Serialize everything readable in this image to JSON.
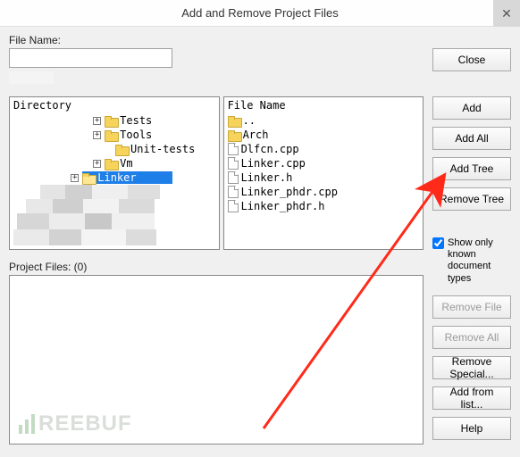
{
  "title": "Add and Remove Project Files",
  "file_name_label": "File Name:",
  "directory_header": "Directory",
  "filelist_header": "File Name",
  "tree": {
    "items": [
      {
        "label": "Tests"
      },
      {
        "label": "Tools"
      },
      {
        "label": "Unit-tests"
      },
      {
        "label": "Vm"
      },
      {
        "label": "Linker",
        "selected": true
      }
    ]
  },
  "files": {
    "items": [
      {
        "label": "..",
        "icon": "folder"
      },
      {
        "label": "Arch",
        "icon": "folder"
      },
      {
        "label": "Dlfcn.cpp",
        "icon": "file"
      },
      {
        "label": "Linker.cpp",
        "icon": "file"
      },
      {
        "label": "Linker.h",
        "icon": "file"
      },
      {
        "label": "Linker_phdr.cpp",
        "icon": "file"
      },
      {
        "label": "Linker_phdr.h",
        "icon": "file"
      }
    ]
  },
  "project_files_label": "Project Files: (0)",
  "checkbox_label": "Show only known document types",
  "buttons": {
    "close": "Close",
    "add": "Add",
    "add_all": "Add All",
    "add_tree": "Add Tree",
    "remove_tree": "Remove Tree",
    "remove_file": "Remove File",
    "remove_all": "Remove All",
    "remove_special": "Remove Special...",
    "add_from_list": "Add from list...",
    "help": "Help"
  },
  "watermark": "REEBUF"
}
